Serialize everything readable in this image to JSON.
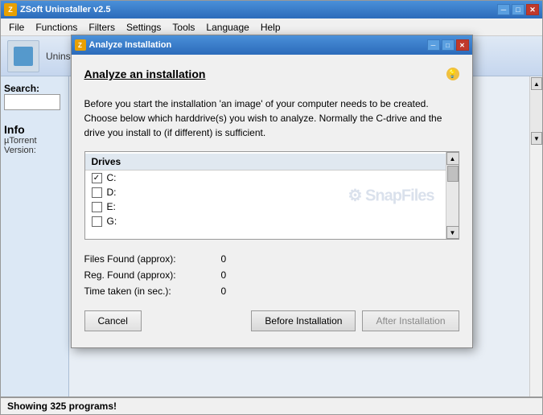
{
  "app": {
    "title": "ZSoft Uninstaller v2.5",
    "icon": "Z"
  },
  "titlebar": {
    "minimize": "─",
    "restore": "□",
    "close": "✕"
  },
  "menubar": {
    "items": [
      "File",
      "Functions",
      "Filters",
      "Settings",
      "Tools",
      "Language",
      "Help"
    ]
  },
  "leftpanel": {
    "search_label": "Search:",
    "info_title": "Info",
    "info_name": "µTorrent",
    "info_version": "Version:"
  },
  "statusbar": {
    "text": "Showing 325 programs!"
  },
  "dialog": {
    "title": "Analyze Installation",
    "icon": "Z",
    "main_title": "Analyze an installation",
    "description": "Before you start the installation 'an image' of your computer needs to be created. Choose below which harddrive(s) you wish to analyze. Normally the C-drive and the drive you install to (if different) is sufficient.",
    "drives_header": "Drives",
    "drives": [
      {
        "label": "C:",
        "checked": true
      },
      {
        "label": "D:",
        "checked": false
      },
      {
        "label": "E:",
        "checked": false
      },
      {
        "label": "G:",
        "checked": false
      }
    ],
    "stats": [
      {
        "label": "Files Found (approx):",
        "value": "0"
      },
      {
        "label": "Reg. Found (approx):",
        "value": "0"
      },
      {
        "label": "Time taken (in sec.):",
        "value": "0"
      }
    ],
    "cancel_label": "Cancel",
    "before_label": "Before Installation",
    "after_label": "After Installation",
    "hint_icon": "💡"
  }
}
